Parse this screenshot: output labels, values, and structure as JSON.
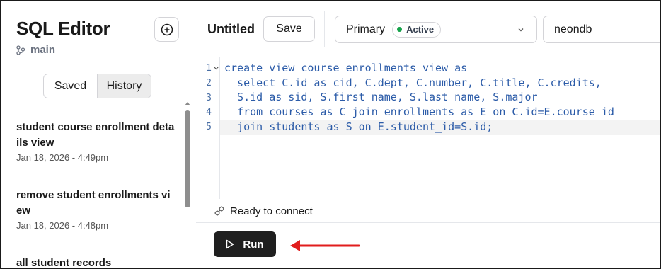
{
  "sidebar": {
    "title": "SQL Editor",
    "branch": "main",
    "add_icon": "plus-circle-icon",
    "tabs": [
      "Saved",
      "History"
    ],
    "active_tab": "History",
    "items": [
      {
        "title": "student course enrollment details view",
        "date": "Jan 18, 2026 - 4:49pm"
      },
      {
        "title": "remove student enrollments view",
        "date": "Jan 18, 2026 - 4:48pm"
      },
      {
        "title": "all student records",
        "date": ""
      }
    ]
  },
  "toolbar": {
    "query_title": "Untitled",
    "save_label": "Save",
    "branch_name": "Primary",
    "branch_status": "Active",
    "database": "neondb"
  },
  "editor": {
    "line_numbers": [
      "1",
      "2",
      "3",
      "4",
      "5"
    ],
    "lines": [
      "create view course_enrollments_view as",
      "  select C.id as cid, C.dept, C.number, C.title, C.credits,",
      "  S.id as sid, S.first_name, S.last_name, S.major",
      "  from courses as C join enrollments as E on C.id=E.course_id",
      "  join students as S on E.student_id=S.id;"
    ]
  },
  "status": {
    "text": "Ready to connect",
    "icon": "connection-plug-icon"
  },
  "run": {
    "label": "Run",
    "icon": "play-icon"
  },
  "annotation": {
    "icon": "red-arrow-icon",
    "color": "#e11d1d"
  },
  "colors": {
    "status_active": "#15a34a",
    "code_text": "#2b5ba8",
    "run_bg": "#1f1f1f"
  }
}
